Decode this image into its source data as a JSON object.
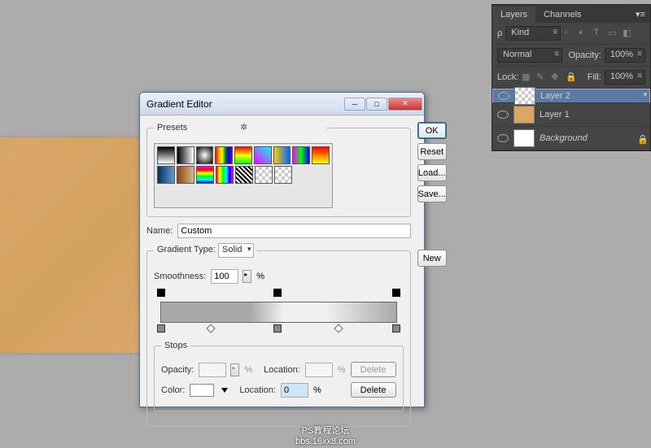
{
  "dialog": {
    "title": "Gradient Editor",
    "presets_label": "Presets",
    "name_label": "Name:",
    "name_value": "Custom",
    "gradient_type_label": "Gradient Type:",
    "gradient_type_value": "Solid",
    "smoothness_label": "Smoothness:",
    "smoothness_value": "100",
    "smoothness_unit": "%",
    "stops_label": "Stops",
    "opacity_label": "Opacity:",
    "opacity_unit": "%",
    "location_label": "Location:",
    "location_value": "0",
    "location_unit": "%",
    "color_label": "Color:",
    "buttons": {
      "ok": "OK",
      "reset": "Reset",
      "load": "Load...",
      "save": "Save...",
      "new": "New",
      "delete": "Delete"
    }
  },
  "layers_panel": {
    "tabs": {
      "layers": "Layers",
      "channels": "Channels"
    },
    "kind_label": "Kind",
    "blend_mode": "Normal",
    "opacity_label": "Opacity:",
    "opacity_value": "100%",
    "lock_label": "Lock:",
    "fill_label": "Fill:",
    "fill_value": "100%",
    "layers": [
      {
        "name": "Layer 2"
      },
      {
        "name": "Layer 1"
      },
      {
        "name": "Background"
      }
    ]
  },
  "watermark": {
    "line1": "PS教程论坛",
    "line2": "bbs.16xx8.com"
  }
}
